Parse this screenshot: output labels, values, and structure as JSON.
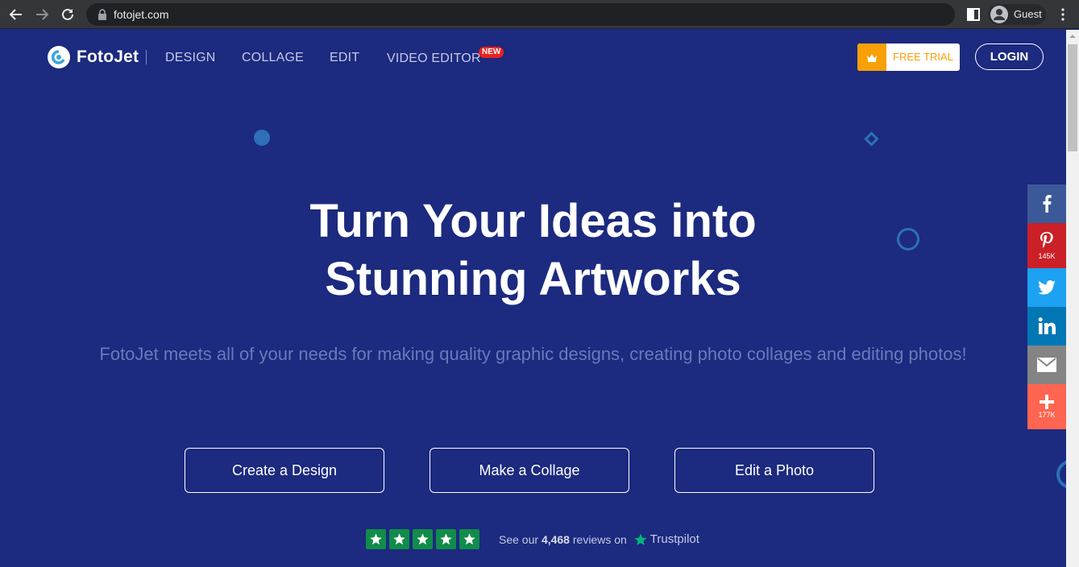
{
  "browser": {
    "url": "fotojet.com",
    "profile_name": "Guest"
  },
  "header": {
    "logo_text": "FotoJet",
    "nav": [
      {
        "label": "DESIGN"
      },
      {
        "label": "COLLAGE"
      },
      {
        "label": "EDIT"
      },
      {
        "label": "VIDEO EDITOR",
        "badge": "NEW"
      }
    ],
    "free_trial_label": "FREE TRIAL",
    "login_label": "LOGIN"
  },
  "hero": {
    "title_line1": "Turn Your Ideas into",
    "title_line2": "Stunning Artworks",
    "subtitle": "FotoJet meets all of your needs for making quality graphic designs, creating photo collages and editing photos!",
    "buttons": [
      {
        "label": "Create a Design"
      },
      {
        "label": "Make a Collage"
      },
      {
        "label": "Edit a Photo"
      }
    ]
  },
  "trustpilot": {
    "rating_stars": 5,
    "prefix": "See our",
    "review_count": "4,468",
    "suffix": "reviews on",
    "brand": "Trustpilot"
  },
  "share": {
    "pinterest_count": "145K",
    "more_count": "177K"
  },
  "colors": {
    "background": "#1c2a7f",
    "accent_orange": "#f7a007",
    "new_badge": "#e8221e",
    "trustpilot_green": "#118c4a",
    "facebook": "#3b5998",
    "pinterest": "#cb2027",
    "twitter": "#1da1f2",
    "linkedin": "#0077b5",
    "email": "#848484",
    "more": "#ff6550"
  }
}
